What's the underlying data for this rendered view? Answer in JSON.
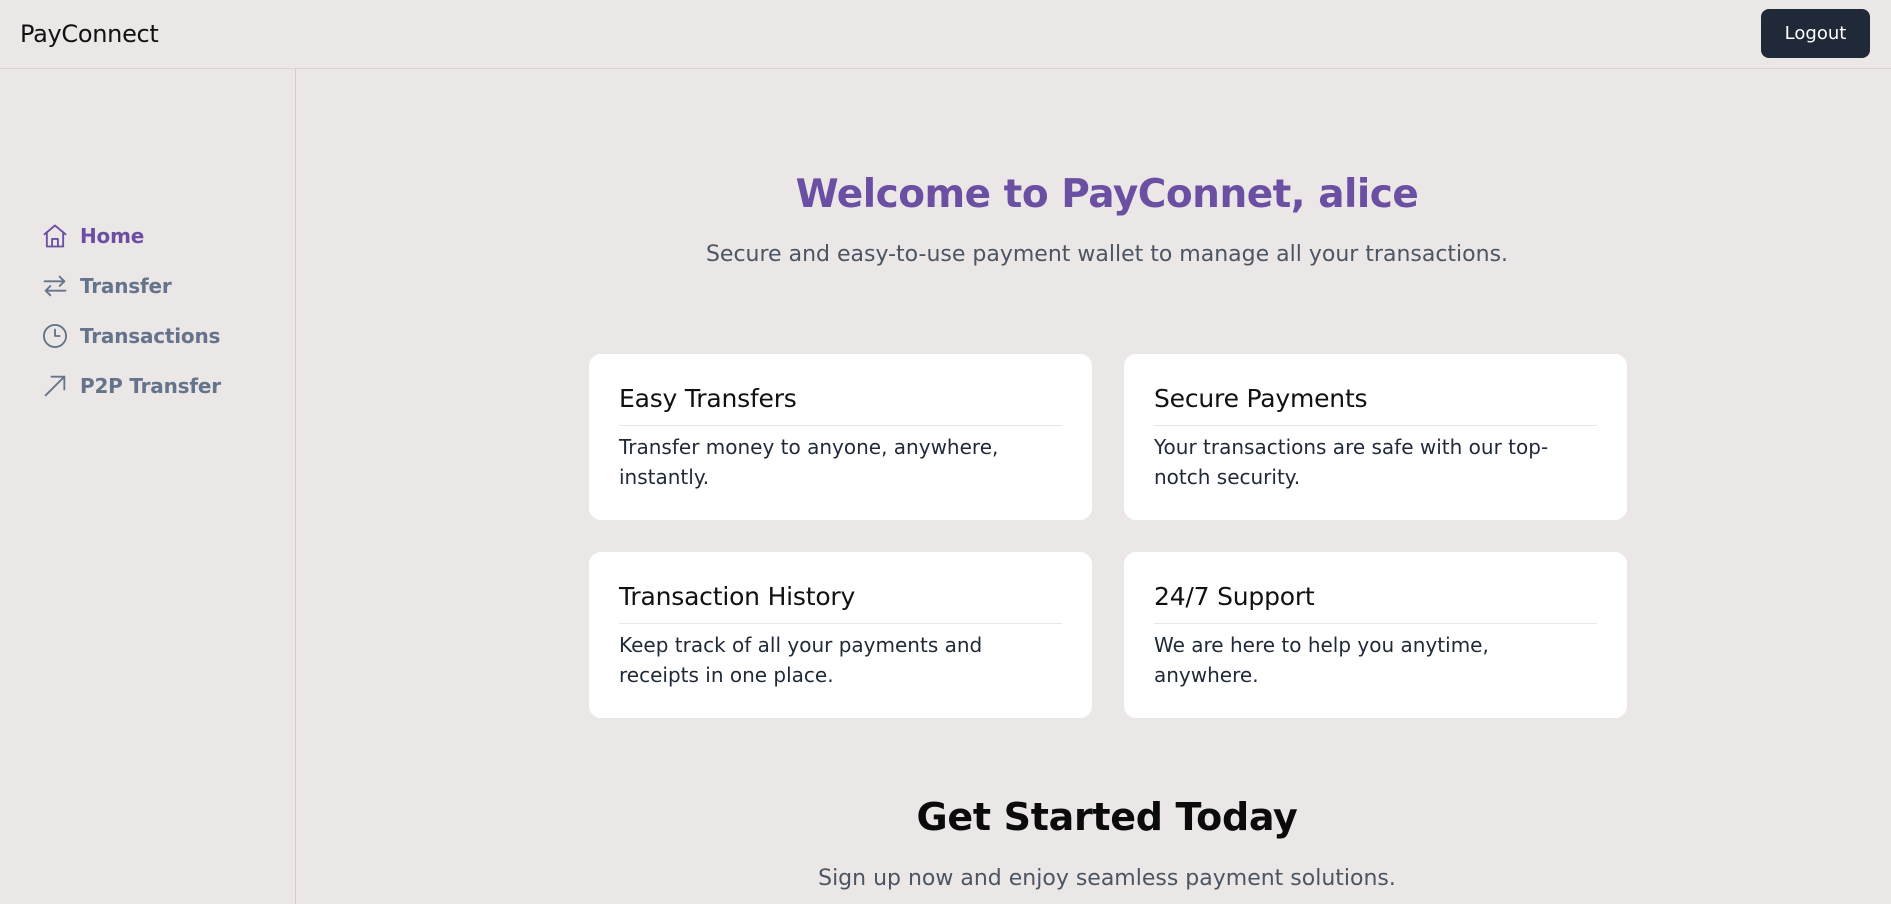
{
  "header": {
    "brand": "PayConnect",
    "logout_label": "Logout"
  },
  "sidebar": {
    "items": [
      {
        "label": "Home",
        "icon": "home-icon",
        "active": true
      },
      {
        "label": "Transfer",
        "icon": "arrows-left-right-icon",
        "active": false
      },
      {
        "label": "Transactions",
        "icon": "clock-icon",
        "active": false
      },
      {
        "label": "P2P Transfer",
        "icon": "arrow-up-right-icon",
        "active": false
      }
    ]
  },
  "main": {
    "welcome": "Welcome to PayConnet, alice",
    "subtitle": "Secure and easy-to-use payment wallet to manage all your transactions.",
    "cards": [
      {
        "title": "Easy Transfers",
        "description": "Transfer money to anyone, anywhere, instantly."
      },
      {
        "title": "Secure Payments",
        "description": "Your transactions are safe with our top-notch security."
      },
      {
        "title": "Transaction History",
        "description": "Keep track of all your payments and receipts in one place."
      },
      {
        "title": "24/7 Support",
        "description": "We are here to help you anytime, anywhere."
      }
    ],
    "cta_title": "Get Started Today",
    "cta_text": "Sign up now and enjoy seamless payment solutions."
  },
  "colors": {
    "background": "#ebe7e6",
    "accent": "#6b4fa3",
    "nav_inactive": "#64748b",
    "logout_bg": "#1f2937",
    "card_bg": "#ffffff"
  }
}
